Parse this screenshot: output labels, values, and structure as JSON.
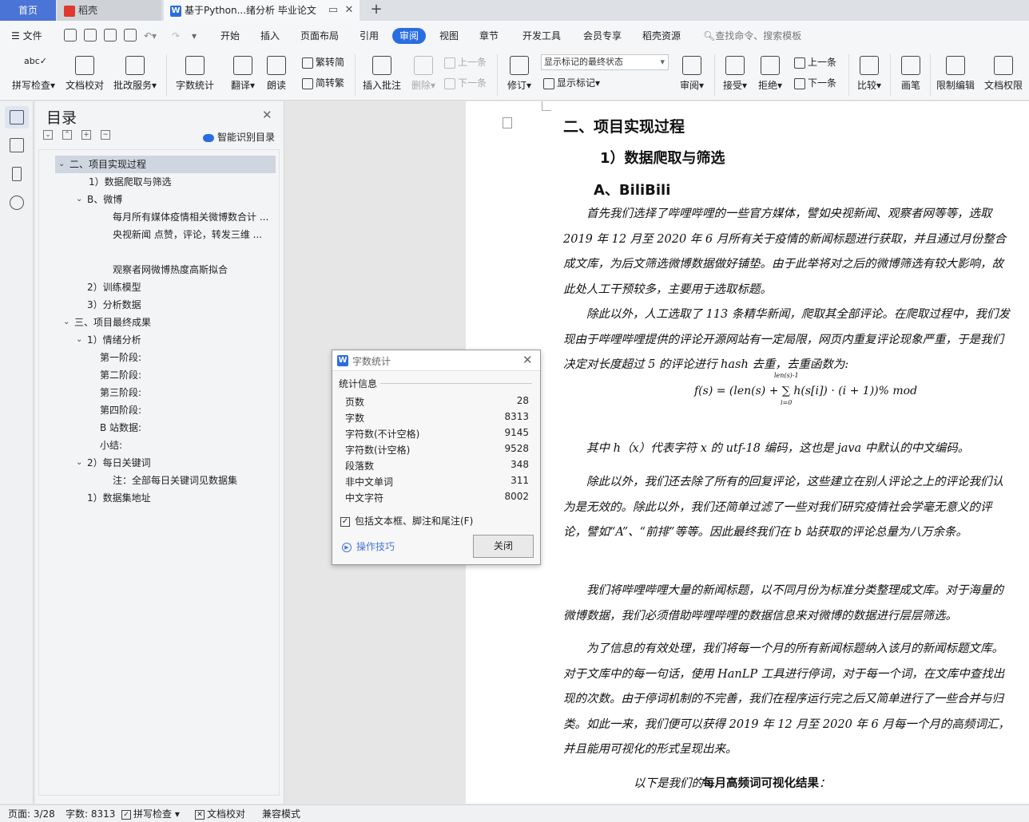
{
  "tabs": {
    "home": "首页",
    "daoke": "稻壳",
    "doc": "基于Python...绪分析 毕业论文"
  },
  "menu": {
    "file": "文件",
    "items": [
      "开始",
      "插入",
      "页面布局",
      "引用",
      "审阅",
      "视图",
      "章节",
      "开发工具",
      "会员专享",
      "稻壳资源"
    ],
    "search": "查找命令、搜索模板"
  },
  "ribbon": {
    "spell": "拼写检查",
    "proof": "文档校对",
    "revise_service": "批改服务",
    "wordcount": "字数统计",
    "translate": "翻译",
    "read": "朗读",
    "trad": "繁转简",
    "simp": "简转繁",
    "insert_comment": "插入批注",
    "delete": "删除",
    "prev": "上一条",
    "next": "下一条",
    "revise": "修订",
    "markup_state": "显示标记的最终状态",
    "show_markup": "显示标记",
    "review": "审阅",
    "accept": "接受",
    "reject": "拒绝",
    "prev2": "上一条",
    "next2": "下一条",
    "compare": "比较",
    "pen": "画笔",
    "restrict": "限制编辑",
    "perm": "文档权限"
  },
  "toc": {
    "title": "目录",
    "smart": "智能识别目录",
    "items": [
      "二、项目实现过程",
      "1）数据爬取与筛选",
      "B、微博",
      "每月所有媒体疫情相关微博数合计 ...",
      "央视新闻 点赞，评论，转发三维 ...",
      "观察者网微博热度高斯拟合",
      "2）训练模型",
      "3）分析数据",
      "三、项目最终成果",
      "1）情绪分析",
      "第一阶段:",
      "第二阶段:",
      "第三阶段:",
      "第四阶段:",
      "B 站数据:",
      "小结:",
      "2）每日关键词",
      "注：全部每日关键词见数据集",
      "1）数据集地址"
    ]
  },
  "doc": {
    "h1": "二、项目实现过程",
    "h2": "1）数据爬取与筛选",
    "h3": "A、BiliBili",
    "p1": "首先我们选择了哔哩哔哩的一些官方媒体，譬如央视新闻、观察者网等等，选取 2019 年 12 月至 2020 年 6 月所有关于疫情的新闻标题进行获取，并且通过月份整合成文库，为后文筛选微博数据做好铺垫。由于此举将对之后的微博筛选有较大影响，故此处人工干预较多，主要用于选取标题。",
    "p2": "除此以外，人工选取了 113 条精华新闻，爬取其全部评论。在爬取过程中，我们发现由于哔哩哔哩提供的评论开源网站有一定局限，网页内重复评论现象严重，于是我们决定对长度超过 5 的评论进行 hash 去重，去重函数为:",
    "formula": "f(s) = (len(s) + ∑ h(s[i]) · (i + 1))% mod",
    "formula_sup": "len(s)-1",
    "formula_sub": "i=0",
    "p3": "其中 h（x）代表字符 x 的 utf-18 编码，这也是 java 中默认的中文编码。",
    "p4": "除此以外，我们还去除了所有的回复评论，这些建立在别人评论之上的评论我们认为是无效的。除此以外，我们还简单过滤了一些对我们研究疫情社会学毫无意义的评论，譬如“A”、“前排”等等。因此最终我们在 b 站获取的评论总量为八万余条。",
    "p5": "我们将哔哩哔哩大量的新闻标题，以不同月份为标准分类整理成文库。对于海量的微博数据，我们必须借助哔哩哔哩的数据信息来对微博的数据进行层层筛选。",
    "p6": "为了信息的有效处理，我们将每一个月的所有新闻标题纳入该月的新闻标题文库。对于文库中的每一句话，使用 HanLP 工具进行停词，对于每一个词，在文库中查找出现的次数。由于停词机制的不完善，我们在程序运行完之后又简单进行了一些合并与归类。如此一来，我们便可以获得 2019 年 12 月至 2020 年 6 月每一个月的高频词汇，并且能用可视化的形式呈现出来。",
    "final_pre": "以下是我们的",
    "final_bold": "每月高频词可视化结果",
    "final_post": "："
  },
  "dialog": {
    "title": "字数统计",
    "section": "统计信息",
    "rows": [
      {
        "label": "页数",
        "value": "28"
      },
      {
        "label": "字数",
        "value": "8313"
      },
      {
        "label": "字符数(不计空格)",
        "value": "9145"
      },
      {
        "label": "字符数(计空格)",
        "value": "9528"
      },
      {
        "label": "段落数",
        "value": "348"
      },
      {
        "label": "非中文单词",
        "value": "311"
      },
      {
        "label": "中文字符",
        "value": "8002"
      }
    ],
    "checkbox": "包括文本框、脚注和尾注(F)",
    "tips": "操作技巧",
    "close": "关闭"
  },
  "status": {
    "page": "页面: 3/28",
    "words": "字数: 8313",
    "spell": "拼写检查",
    "proof": "文档校对",
    "compat": "兼容模式"
  },
  "colors": {
    "accent": "#2a6de0",
    "home_tab": "#4a74d6",
    "toc_selected": "#cfd6e0"
  }
}
